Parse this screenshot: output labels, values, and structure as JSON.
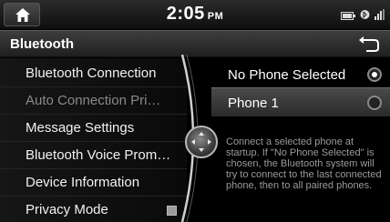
{
  "status": {
    "time": "2:05",
    "ampm": "PM",
    "icons": [
      "home-icon",
      "battery-icon",
      "bluetooth-phone-icon",
      "signal-icon"
    ]
  },
  "header": {
    "title": "Bluetooth",
    "back_icon": "back-arrow-icon"
  },
  "menu": {
    "items": [
      {
        "label": "Bluetooth Connection"
      },
      {
        "label": "Auto Connection Pri…"
      },
      {
        "label": "Message Settings"
      },
      {
        "label": "Bluetooth Voice Prom…"
      },
      {
        "label": "Device Information"
      },
      {
        "label": "Privacy Mode"
      }
    ]
  },
  "options": {
    "items": [
      {
        "label": "No Phone Selected",
        "selected": true
      },
      {
        "label": "Phone 1",
        "selected": false
      }
    ],
    "description": "Connect a selected phone at startup. If \"No Phone Selected\" is chosen, the Bluetooth system will try to connect to the last connected phone, then to all paired phones."
  }
}
